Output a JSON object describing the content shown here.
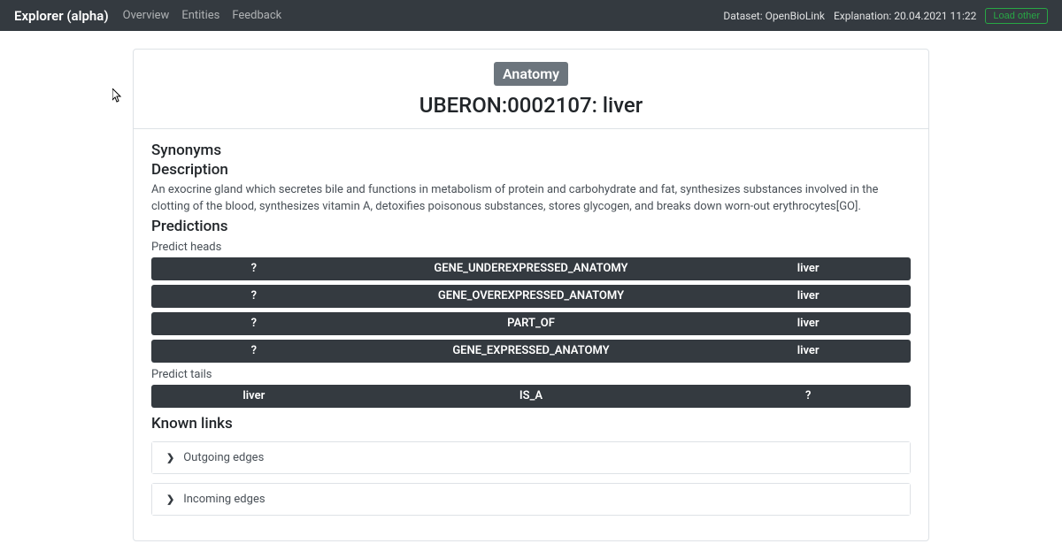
{
  "navbar": {
    "brand": "Explorer (alpha)",
    "links": [
      "Overview",
      "Entities",
      "Feedback"
    ],
    "dataset_label": "Dataset: OpenBioLink",
    "explanation_label": "Explanation: 20.04.2021 11:22",
    "load_other_label": "Load other"
  },
  "entity": {
    "category_badge": "Anatomy",
    "title": "UBERON:0002107: liver"
  },
  "sections": {
    "synonyms_heading": "Synonyms",
    "description_heading": "Description",
    "description_text": "An exocrine gland which secretes bile and functions in metabolism of protein and carbohydrate and fat, synthesizes substances involved in the clotting of the blood, synthesizes vitamin A, detoxifies poisonous substances, stores glycogen, and breaks down worn-out erythrocytes[GO].",
    "predictions_heading": "Predictions",
    "predict_heads_label": "Predict heads",
    "predict_tails_label": "Predict tails",
    "known_links_heading": "Known links",
    "outgoing_label": "Outgoing edges",
    "incoming_label": "Incoming edges"
  },
  "predict_heads": [
    {
      "head": "?",
      "rel": "GENE_UNDEREXPRESSED_ANATOMY",
      "tail": "liver"
    },
    {
      "head": "?",
      "rel": "GENE_OVEREXPRESSED_ANATOMY",
      "tail": "liver"
    },
    {
      "head": "?",
      "rel": "PART_OF",
      "tail": "liver"
    },
    {
      "head": "?",
      "rel": "GENE_EXPRESSED_ANATOMY",
      "tail": "liver"
    }
  ],
  "predict_tails": [
    {
      "head": "liver",
      "rel": "IS_A",
      "tail": "?"
    }
  ]
}
